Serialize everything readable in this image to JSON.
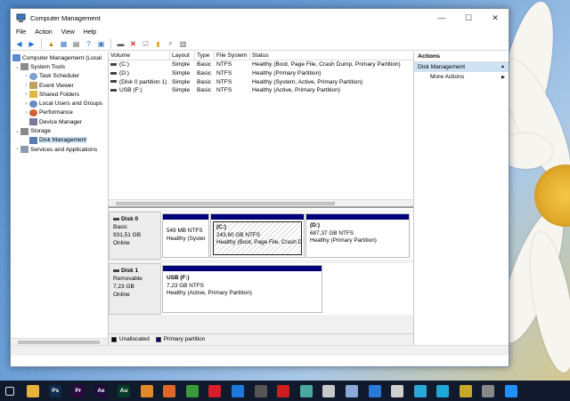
{
  "window": {
    "title": "Computer Management",
    "controls": {
      "minimize": "—",
      "maximize": "☐",
      "close": "✕"
    }
  },
  "menu": [
    "File",
    "Action",
    "View",
    "Help"
  ],
  "toolbar_icons": [
    "back-icon",
    "forward-icon",
    "up-icon",
    "show-hide-tree-icon",
    "properties-icon",
    "help-icon",
    "view-icon",
    "disk-connect-icon",
    "delete-icon",
    "check-icon",
    "folder-icon",
    "search-icon",
    "panel-icon"
  ],
  "tree": {
    "root": "Computer Management (Local",
    "system_tools": "System Tools",
    "task_scheduler": "Task Scheduler",
    "event_viewer": "Event Viewer",
    "shared_folders": "Shared Folders",
    "local_users": "Local Users and Groups",
    "performance": "Performance",
    "device_manager": "Device Manager",
    "storage": "Storage",
    "disk_management": "Disk Management",
    "services": "Services and Applications"
  },
  "volume_list": {
    "headers": [
      "Volume",
      "Layout",
      "Type",
      "File System",
      "Status"
    ],
    "rows": [
      [
        "(C:)",
        "Simple",
        "Basic",
        "NTFS",
        "Healthy (Boot, Page File, Crash Dump, Primary Partition)"
      ],
      [
        "(D:)",
        "Simple",
        "Basic",
        "NTFS",
        "Healthy (Primary Partition)"
      ],
      [
        "(Disk 0 partition 1)",
        "Simple",
        "Basic",
        "NTFS",
        "Healthy (System, Active, Primary Partition)"
      ],
      [
        "USB (F:)",
        "Simple",
        "Basic",
        "NTFS",
        "Healthy (Active, Primary Partition)"
      ]
    ]
  },
  "disk0": {
    "name": "Disk 0",
    "type": "Basic",
    "size": "931,51 GB",
    "state": "Online",
    "p1": {
      "size": "549 MB NTFS",
      "status": "Healthy (Syster"
    },
    "p2": {
      "name": "(C:)",
      "size": "243,60 GB NTFS",
      "status": "Healthy (Boot, Page File, Crash D"
    },
    "p3": {
      "name": "(D:)",
      "size": "687,37 GB NTFS",
      "status": "Healthy (Primary Partition)"
    }
  },
  "disk1": {
    "name": "Disk 1",
    "type": "Removable",
    "size": "7,23 GB",
    "state": "Online",
    "p1": {
      "name": "USB  (F:)",
      "size": "7,23 GB NTFS",
      "status": "Healthy (Active, Primary Partition)"
    }
  },
  "legend": {
    "unallocated": "Unallocated",
    "primary": "Primary partition"
  },
  "legend_colors": {
    "unallocated": "#000000",
    "primary": "#00007c"
  },
  "actions": {
    "header": "Actions",
    "section": "Disk Management",
    "more": "More Actions"
  },
  "taskbar": [
    {
      "icon": "task-view-icon",
      "label": "",
      "color": "#101a2c"
    },
    {
      "icon": "file-explorer-icon",
      "label": "",
      "color": "#e8b13c"
    },
    {
      "icon": "photoshop-icon",
      "label": "Ps",
      "color": "#0f2a4a"
    },
    {
      "icon": "premiere-icon",
      "label": "Pr",
      "color": "#2a0a3a"
    },
    {
      "icon": "after-effects-icon",
      "label": "Ae",
      "color": "#1f0a3a"
    },
    {
      "icon": "audition-icon",
      "label": "Au",
      "color": "#0a3a2a"
    },
    {
      "icon": "sublime-icon",
      "label": "",
      "color": "#e08a2a"
    },
    {
      "icon": "firefox-icon",
      "label": "",
      "color": "#e0662a"
    },
    {
      "icon": "chrome-icon",
      "label": "",
      "color": "#3a9a3a"
    },
    {
      "icon": "opera-icon",
      "label": "",
      "color": "#d81e2a"
    },
    {
      "icon": "edge-icon",
      "label": "",
      "color": "#1e7ad8"
    },
    {
      "icon": "davinci-icon",
      "label": "",
      "color": "#555555"
    },
    {
      "icon": "record-icon",
      "label": "",
      "color": "#cc1e1e"
    },
    {
      "icon": "notepad-icon",
      "label": "",
      "color": "#4aa8a0"
    },
    {
      "icon": "paint-icon",
      "label": "",
      "color": "#c8c8c8"
    },
    {
      "icon": "palette-icon",
      "label": "",
      "color": "#8aa8d8"
    },
    {
      "icon": "vs-code-icon",
      "label": "",
      "color": "#2a7ad8"
    },
    {
      "icon": "gamepad-icon",
      "label": "",
      "color": "#cfcfcf"
    },
    {
      "icon": "controller-icon",
      "label": "",
      "color": "#2aa8d8"
    },
    {
      "icon": "dolphin-icon",
      "label": "",
      "color": "#1ea8d8"
    },
    {
      "icon": "cmd-icon",
      "label": "",
      "color": "#c8a82a"
    },
    {
      "icon": "disk-tool-icon",
      "label": "",
      "color": "#888888"
    },
    {
      "icon": "app-icon",
      "label": "",
      "color": "#1e90ff"
    }
  ]
}
